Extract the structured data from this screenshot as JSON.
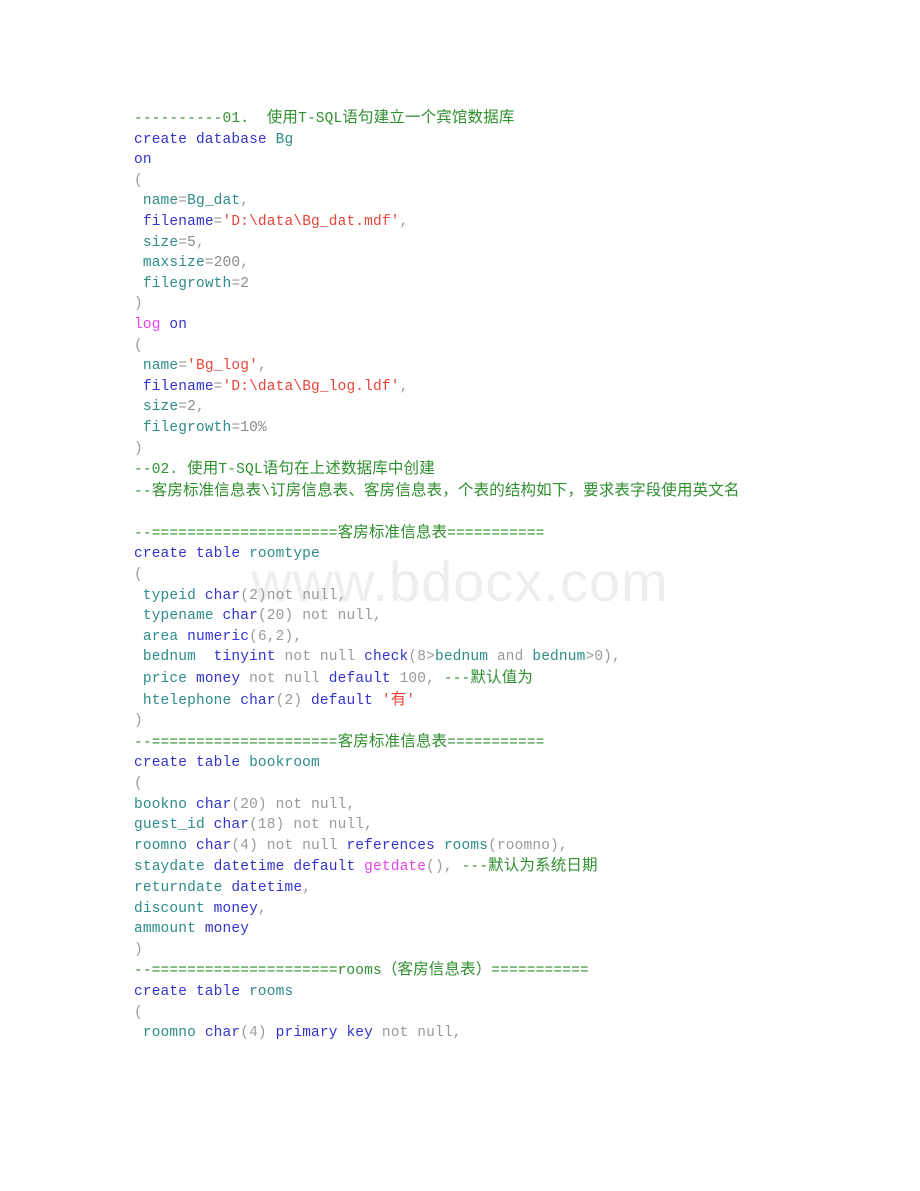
{
  "document": {
    "watermark": "www.bdocx.com",
    "language": "T-SQL",
    "colors": {
      "comment": "#2f8f2f",
      "keyword": "#3333cc",
      "identifier": "#2e8b8b",
      "function": "#e642e6",
      "string": "#e8443a",
      "plain": "#9a9a9a",
      "background": "#ffffff",
      "watermark": "#eeeeee"
    }
  },
  "code_lines": [
    {
      "id": "l01",
      "tokens": [
        {
          "t": "----------01.  使用T-SQL语句建立一个宾馆数据库",
          "c": "cmt"
        }
      ]
    },
    {
      "id": "l02",
      "tokens": [
        {
          "t": "create database ",
          "c": "kw"
        },
        {
          "t": "Bg",
          "c": "id"
        }
      ]
    },
    {
      "id": "l03",
      "tokens": [
        {
          "t": "on",
          "c": "kw"
        }
      ]
    },
    {
      "id": "l04",
      "tokens": [
        {
          "t": "(",
          "c": "pl"
        }
      ]
    },
    {
      "id": "l05",
      "tokens": [
        {
          "t": " ",
          "c": "pl"
        },
        {
          "t": "name",
          "c": "id"
        },
        {
          "t": "=",
          "c": "pl"
        },
        {
          "t": "Bg_dat",
          "c": "id"
        },
        {
          "t": ",",
          "c": "pl"
        }
      ]
    },
    {
      "id": "l06",
      "tokens": [
        {
          "t": " ",
          "c": "pl"
        },
        {
          "t": "filename",
          "c": "kw"
        },
        {
          "t": "=",
          "c": "pl"
        },
        {
          "t": "'D:\\data\\Bg_dat.mdf'",
          "c": "str"
        },
        {
          "t": ",",
          "c": "pl"
        }
      ]
    },
    {
      "id": "l07",
      "tokens": [
        {
          "t": " ",
          "c": "pl"
        },
        {
          "t": "size",
          "c": "id"
        },
        {
          "t": "=",
          "c": "pl"
        },
        {
          "t": "5",
          "c": "num"
        },
        {
          "t": ",",
          "c": "pl"
        }
      ]
    },
    {
      "id": "l08",
      "tokens": [
        {
          "t": " ",
          "c": "pl"
        },
        {
          "t": "maxsize",
          "c": "id"
        },
        {
          "t": "=",
          "c": "pl"
        },
        {
          "t": "200",
          "c": "num"
        },
        {
          "t": ",",
          "c": "pl"
        }
      ]
    },
    {
      "id": "l09",
      "tokens": [
        {
          "t": " ",
          "c": "pl"
        },
        {
          "t": "filegrowth",
          "c": "id"
        },
        {
          "t": "=",
          "c": "pl"
        },
        {
          "t": "2",
          "c": "num"
        }
      ]
    },
    {
      "id": "l10",
      "tokens": [
        {
          "t": ")",
          "c": "pl"
        }
      ]
    },
    {
      "id": "l11",
      "tokens": [
        {
          "t": "log",
          "c": "fn"
        },
        {
          "t": " ",
          "c": "pl"
        },
        {
          "t": "on",
          "c": "kw"
        }
      ]
    },
    {
      "id": "l12",
      "tokens": [
        {
          "t": "(",
          "c": "pl"
        }
      ]
    },
    {
      "id": "l13",
      "tokens": [
        {
          "t": " ",
          "c": "pl"
        },
        {
          "t": "name",
          "c": "id"
        },
        {
          "t": "=",
          "c": "pl"
        },
        {
          "t": "'Bg_log'",
          "c": "str"
        },
        {
          "t": ",",
          "c": "pl"
        }
      ]
    },
    {
      "id": "l14",
      "tokens": [
        {
          "t": " ",
          "c": "pl"
        },
        {
          "t": "filename",
          "c": "kw"
        },
        {
          "t": "=",
          "c": "pl"
        },
        {
          "t": "'D:\\data\\Bg_log.ldf'",
          "c": "str"
        },
        {
          "t": ",",
          "c": "pl"
        }
      ]
    },
    {
      "id": "l15",
      "tokens": [
        {
          "t": " ",
          "c": "pl"
        },
        {
          "t": "size",
          "c": "id"
        },
        {
          "t": "=",
          "c": "pl"
        },
        {
          "t": "2",
          "c": "num"
        },
        {
          "t": ",",
          "c": "pl"
        }
      ]
    },
    {
      "id": "l16",
      "tokens": [
        {
          "t": " ",
          "c": "pl"
        },
        {
          "t": "filegrowth",
          "c": "id"
        },
        {
          "t": "=",
          "c": "pl"
        },
        {
          "t": "10%",
          "c": "num"
        }
      ]
    },
    {
      "id": "l17",
      "tokens": [
        {
          "t": ")",
          "c": "pl"
        }
      ]
    },
    {
      "id": "l18",
      "tokens": [
        {
          "t": "--02. 使用T-SQL语句在上述数据库中创建",
          "c": "cmt"
        }
      ]
    },
    {
      "id": "l19",
      "tokens": [
        {
          "t": "--客房标准信息表\\订房信息表、客房信息表，个表的结构如下，要求表字段使用英文名",
          "c": "cmt"
        }
      ]
    },
    {
      "id": "l20",
      "tokens": [
        {
          "t": " ",
          "c": "pl"
        }
      ],
      "blank": true
    },
    {
      "id": "l21",
      "tokens": [
        {
          "t": "--=====================客房标准信息表===========",
          "c": "cmt"
        }
      ]
    },
    {
      "id": "l22",
      "tokens": [
        {
          "t": "create table ",
          "c": "kw"
        },
        {
          "t": "roomtype",
          "c": "id"
        }
      ]
    },
    {
      "id": "l23",
      "tokens": [
        {
          "t": "(",
          "c": "pl"
        }
      ]
    },
    {
      "id": "l24",
      "tokens": [
        {
          "t": " ",
          "c": "pl"
        },
        {
          "t": "typeid",
          "c": "id"
        },
        {
          "t": " ",
          "c": "pl"
        },
        {
          "t": "char",
          "c": "kw"
        },
        {
          "t": "(2)",
          "c": "pl"
        },
        {
          "t": "not null",
          "c": "pl"
        },
        {
          "t": ",",
          "c": "pl"
        }
      ]
    },
    {
      "id": "l25",
      "tokens": [
        {
          "t": " ",
          "c": "pl"
        },
        {
          "t": "typename",
          "c": "id"
        },
        {
          "t": " ",
          "c": "pl"
        },
        {
          "t": "char",
          "c": "kw"
        },
        {
          "t": "(20) ",
          "c": "pl"
        },
        {
          "t": "not null",
          "c": "pl"
        },
        {
          "t": ",",
          "c": "pl"
        }
      ]
    },
    {
      "id": "l26",
      "tokens": [
        {
          "t": " ",
          "c": "pl"
        },
        {
          "t": "area",
          "c": "id"
        },
        {
          "t": " ",
          "c": "pl"
        },
        {
          "t": "numeric",
          "c": "kw"
        },
        {
          "t": "(6,2),",
          "c": "pl"
        }
      ]
    },
    {
      "id": "l27",
      "tokens": [
        {
          "t": " ",
          "c": "pl"
        },
        {
          "t": "bednum",
          "c": "id"
        },
        {
          "t": "  ",
          "c": "pl"
        },
        {
          "t": "tinyint",
          "c": "kw"
        },
        {
          "t": " not null ",
          "c": "pl"
        },
        {
          "t": "check",
          "c": "kw"
        },
        {
          "t": "(8>",
          "c": "pl"
        },
        {
          "t": "bednum",
          "c": "id"
        },
        {
          "t": " and ",
          "c": "pl"
        },
        {
          "t": "bednum",
          "c": "id"
        },
        {
          "t": ">0),",
          "c": "pl"
        }
      ]
    },
    {
      "id": "l28",
      "tokens": [
        {
          "t": " ",
          "c": "pl"
        },
        {
          "t": "price",
          "c": "id"
        },
        {
          "t": " ",
          "c": "pl"
        },
        {
          "t": "money",
          "c": "kw"
        },
        {
          "t": " not null ",
          "c": "pl"
        },
        {
          "t": "default",
          "c": "kw"
        },
        {
          "t": " 100, ",
          "c": "pl"
        },
        {
          "t": "---默认值为",
          "c": "cmt"
        }
      ]
    },
    {
      "id": "l29",
      "tokens": [
        {
          "t": " ",
          "c": "pl"
        },
        {
          "t": "htelephone",
          "c": "id"
        },
        {
          "t": " ",
          "c": "pl"
        },
        {
          "t": "char",
          "c": "kw"
        },
        {
          "t": "(2) ",
          "c": "pl"
        },
        {
          "t": "default",
          "c": "kw"
        },
        {
          "t": " ",
          "c": "pl"
        },
        {
          "t": "'有'",
          "c": "str"
        }
      ]
    },
    {
      "id": "l30",
      "tokens": [
        {
          "t": ")",
          "c": "pl"
        }
      ]
    },
    {
      "id": "l31",
      "tokens": [
        {
          "t": "--=====================客房标准信息表===========",
          "c": "cmt"
        }
      ]
    },
    {
      "id": "l32",
      "tokens": [
        {
          "t": "create table ",
          "c": "kw"
        },
        {
          "t": "bookroom",
          "c": "id"
        }
      ]
    },
    {
      "id": "l33",
      "tokens": [
        {
          "t": "(",
          "c": "pl"
        }
      ]
    },
    {
      "id": "l34",
      "tokens": [
        {
          "t": "bookno",
          "c": "id"
        },
        {
          "t": " ",
          "c": "pl"
        },
        {
          "t": "char",
          "c": "kw"
        },
        {
          "t": "(20) ",
          "c": "pl"
        },
        {
          "t": "not null",
          "c": "pl"
        },
        {
          "t": ",",
          "c": "pl"
        }
      ]
    },
    {
      "id": "l35",
      "tokens": [
        {
          "t": "guest_id",
          "c": "id"
        },
        {
          "t": " ",
          "c": "pl"
        },
        {
          "t": "char",
          "c": "kw"
        },
        {
          "t": "(18) ",
          "c": "pl"
        },
        {
          "t": "not null",
          "c": "pl"
        },
        {
          "t": ",",
          "c": "pl"
        }
      ]
    },
    {
      "id": "l36",
      "tokens": [
        {
          "t": "roomno",
          "c": "id"
        },
        {
          "t": " ",
          "c": "pl"
        },
        {
          "t": "char",
          "c": "kw"
        },
        {
          "t": "(4) ",
          "c": "pl"
        },
        {
          "t": "not null ",
          "c": "pl"
        },
        {
          "t": "references",
          "c": "kw"
        },
        {
          "t": " ",
          "c": "pl"
        },
        {
          "t": "rooms",
          "c": "id"
        },
        {
          "t": "(roomno),",
          "c": "pl"
        }
      ]
    },
    {
      "id": "l37",
      "tokens": [
        {
          "t": "staydate",
          "c": "id"
        },
        {
          "t": " ",
          "c": "pl"
        },
        {
          "t": "datetime",
          "c": "kw"
        },
        {
          "t": " ",
          "c": "pl"
        },
        {
          "t": "default",
          "c": "kw"
        },
        {
          "t": " ",
          "c": "pl"
        },
        {
          "t": "getdate",
          "c": "fn"
        },
        {
          "t": "(), ",
          "c": "pl"
        },
        {
          "t": "---默认为系统日期",
          "c": "cmt"
        }
      ]
    },
    {
      "id": "l38",
      "tokens": [
        {
          "t": "returndate",
          "c": "id"
        },
        {
          "t": " ",
          "c": "pl"
        },
        {
          "t": "datetime",
          "c": "kw"
        },
        {
          "t": ",",
          "c": "pl"
        }
      ]
    },
    {
      "id": "l39",
      "tokens": [
        {
          "t": "discount",
          "c": "id"
        },
        {
          "t": " ",
          "c": "pl"
        },
        {
          "t": "money",
          "c": "kw"
        },
        {
          "t": ",",
          "c": "pl"
        }
      ]
    },
    {
      "id": "l40",
      "tokens": [
        {
          "t": "ammount",
          "c": "id"
        },
        {
          "t": " ",
          "c": "pl"
        },
        {
          "t": "money",
          "c": "kw"
        }
      ]
    },
    {
      "id": "l41",
      "tokens": [
        {
          "t": ")",
          "c": "pl"
        }
      ]
    },
    {
      "id": "l42",
      "tokens": [
        {
          "t": "--=====================rooms（客房信息表）===========",
          "c": "cmt"
        }
      ]
    },
    {
      "id": "l43",
      "tokens": [
        {
          "t": "create table ",
          "c": "kw"
        },
        {
          "t": "rooms",
          "c": "id"
        }
      ]
    },
    {
      "id": "l44",
      "tokens": [
        {
          "t": "(",
          "c": "pl"
        }
      ]
    },
    {
      "id": "l45",
      "tokens": [
        {
          "t": " ",
          "c": "pl"
        },
        {
          "t": "roomno",
          "c": "id"
        },
        {
          "t": " ",
          "c": "pl"
        },
        {
          "t": "char",
          "c": "kw"
        },
        {
          "t": "(4) ",
          "c": "pl"
        },
        {
          "t": "primary key",
          "c": "kw"
        },
        {
          "t": " ",
          "c": "pl"
        },
        {
          "t": "not null",
          "c": "pl"
        },
        {
          "t": ",",
          "c": "pl"
        }
      ]
    }
  ]
}
